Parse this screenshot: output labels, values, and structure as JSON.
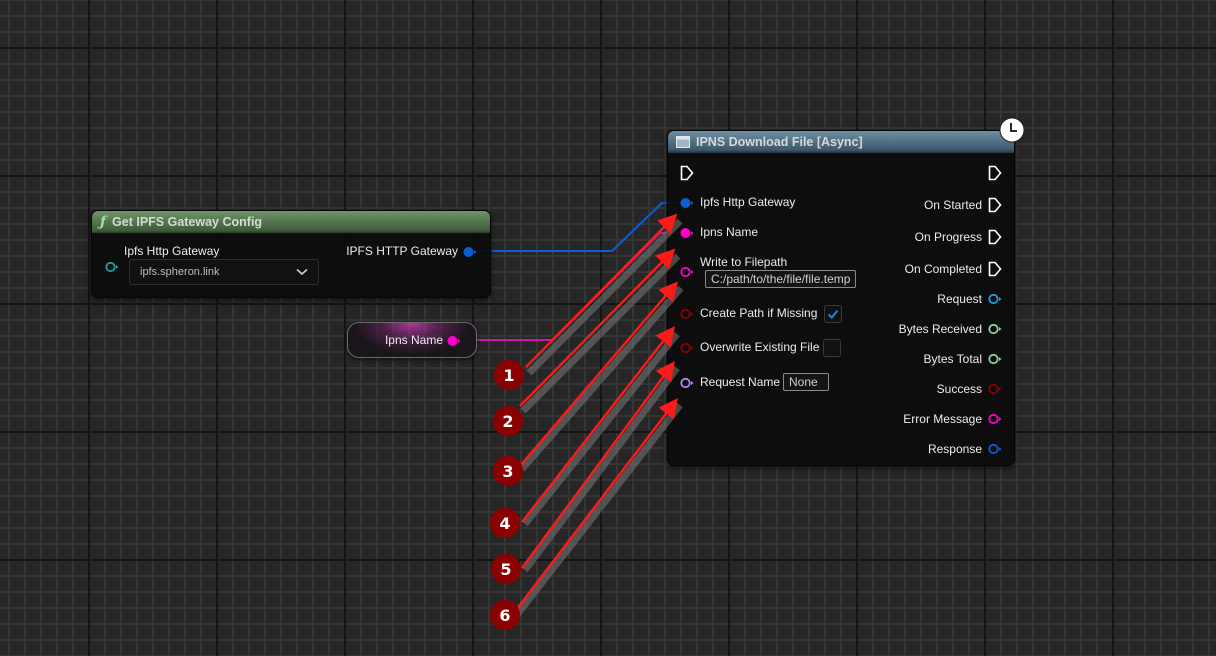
{
  "graph": {
    "nodes": {
      "get_config": {
        "title": "Get IPFS Gateway Config",
        "title_icon": "function-icon",
        "title_icon_glyph": "ƒ",
        "header_color": "#5a7a52",
        "input_label": "Ipfs Http Gateway",
        "dropdown_value": "ipfs.spheron.link",
        "output_label": "IPFS HTTP Gateway"
      },
      "ipns_name_var": {
        "label": "Ipns Name",
        "color": "#ff00cc"
      },
      "download": {
        "title": "IPNS Download File [Async]",
        "title_icon": "window-icon",
        "header_color": "#4e6f86",
        "latent_icon": "clock-icon",
        "inputs": [
          {
            "label": "Ipfs Http Gateway",
            "type": "struct",
            "color": "#0a5fd6",
            "connected": true
          },
          {
            "label": "Ipns Name",
            "type": "string",
            "color": "#ff00cc",
            "connected": true
          },
          {
            "label": "Write to Filepath",
            "type": "string",
            "color": "#ff00cc",
            "connected": false,
            "value": "C:/path/to/the/file/file.temp"
          },
          {
            "label": "Create Path if Missing",
            "type": "bool",
            "color": "#8b0000",
            "connected": false,
            "checked": true
          },
          {
            "label": "Overwrite Existing File",
            "type": "bool",
            "color": "#8b0000",
            "connected": false,
            "checked": false
          },
          {
            "label": "Request Name",
            "type": "name",
            "color": "#c080ff",
            "connected": false,
            "value": "None"
          }
        ],
        "outputs": [
          {
            "label": "On Started",
            "type": "exec"
          },
          {
            "label": "On Progress",
            "type": "exec"
          },
          {
            "label": "On Completed",
            "type": "exec"
          },
          {
            "label": "Request",
            "type": "object",
            "color": "#1e9be8"
          },
          {
            "label": "Bytes Received",
            "type": "int64",
            "color": "#8fd19e"
          },
          {
            "label": "Bytes Total",
            "type": "int64",
            "color": "#8fd19e"
          },
          {
            "label": "Success",
            "type": "bool",
            "color": "#8b0000"
          },
          {
            "label": "Error Message",
            "type": "string",
            "color": "#ff00cc"
          },
          {
            "label": "Response",
            "type": "struct",
            "color": "#0a5fd6"
          }
        ]
      }
    },
    "annotations": [
      "1",
      "2",
      "3",
      "4",
      "5",
      "6"
    ],
    "annotation_color": "#8b0000",
    "arrow_color": "#ff1a1a"
  }
}
